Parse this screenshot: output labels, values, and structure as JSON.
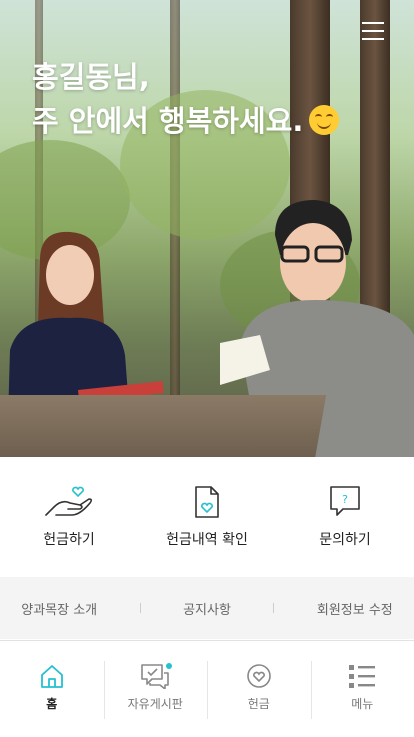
{
  "hero": {
    "greeting_line1": "홍길동님,",
    "greeting_line2": "주 안에서 행복하세요."
  },
  "actions": [
    {
      "label": "헌금하기",
      "icon": "hand-heart-icon"
    },
    {
      "label": "헌금내역 확인",
      "icon": "document-heart-icon"
    },
    {
      "label": "문의하기",
      "icon": "question-bubble-icon"
    }
  ],
  "links": [
    "양과목장 소개",
    "공지사항",
    "회원정보 수정"
  ],
  "tabs": [
    {
      "label": "홈",
      "icon": "home-icon",
      "active": true
    },
    {
      "label": "자유게시판",
      "icon": "board-icon",
      "badge": true
    },
    {
      "label": "헌금",
      "icon": "heart-circle-icon"
    },
    {
      "label": "메뉴",
      "icon": "list-icon"
    }
  ],
  "colors": {
    "accent": "#25c1cf"
  }
}
